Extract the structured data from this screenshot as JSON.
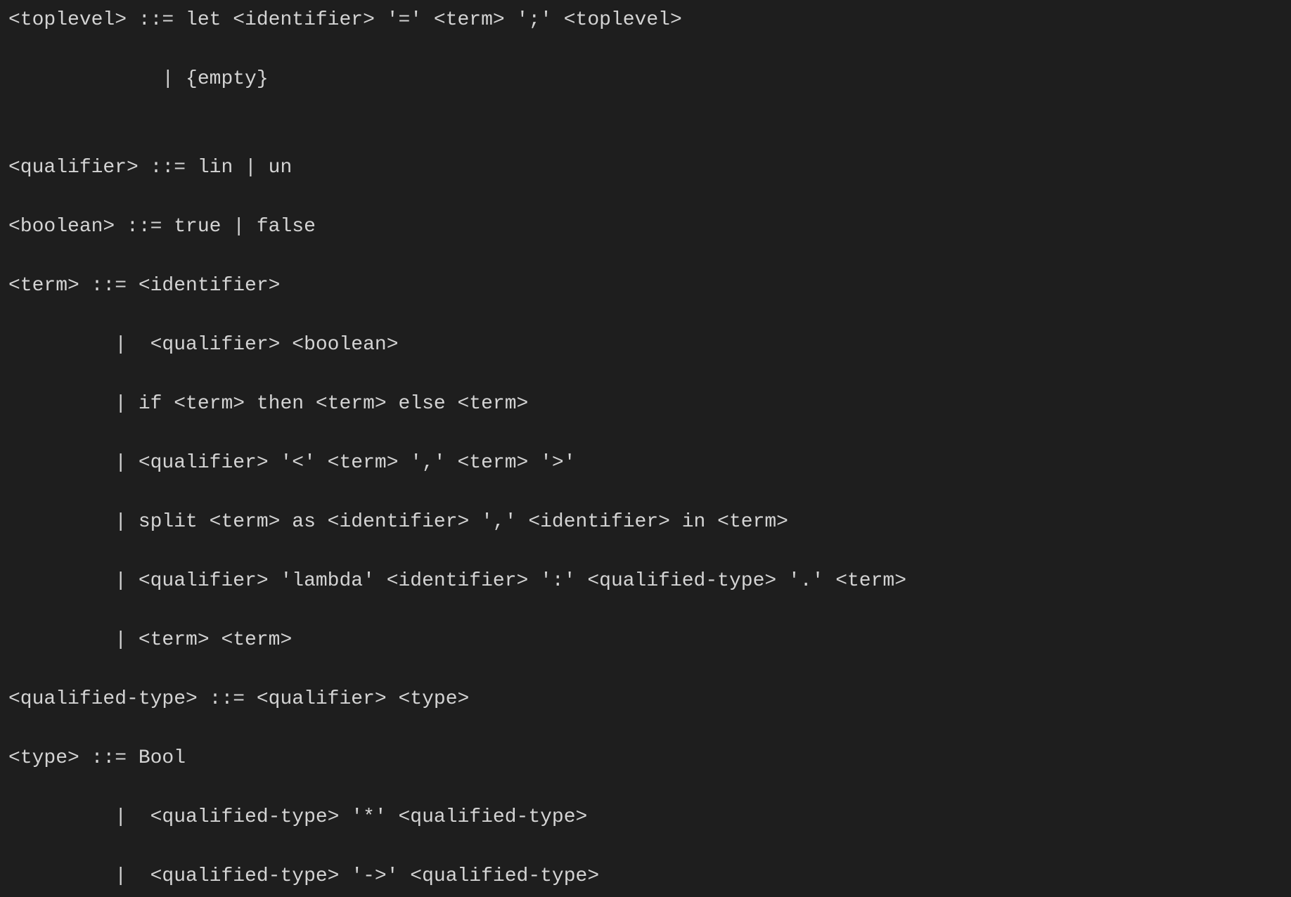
{
  "grammar": {
    "lines": [
      "<toplevel> ::= let <identifier> '=' <term> ';' <toplevel>",
      "             | {empty}",
      "",
      "<qualifier> ::= lin | un",
      "<boolean> ::= true | false",
      "<term> ::= <identifier>",
      "         |  <qualifier> <boolean>",
      "         | if <term> then <term> else <term>",
      "         | <qualifier> '<' <term> ',' <term> '>'",
      "         | split <term> as <identifier> ',' <identifier> in <term>",
      "         | <qualifier> 'lambda' <identifier> ':' <qualified-type> '.' <term>",
      "         | <term> <term>",
      "<qualified-type> ::= <qualifier> <type>",
      "<type> ::= Bool",
      "         |  <qualified-type> '*' <qualified-type>",
      "         |  <qualified-type> '->' <qualified-type>"
    ]
  }
}
